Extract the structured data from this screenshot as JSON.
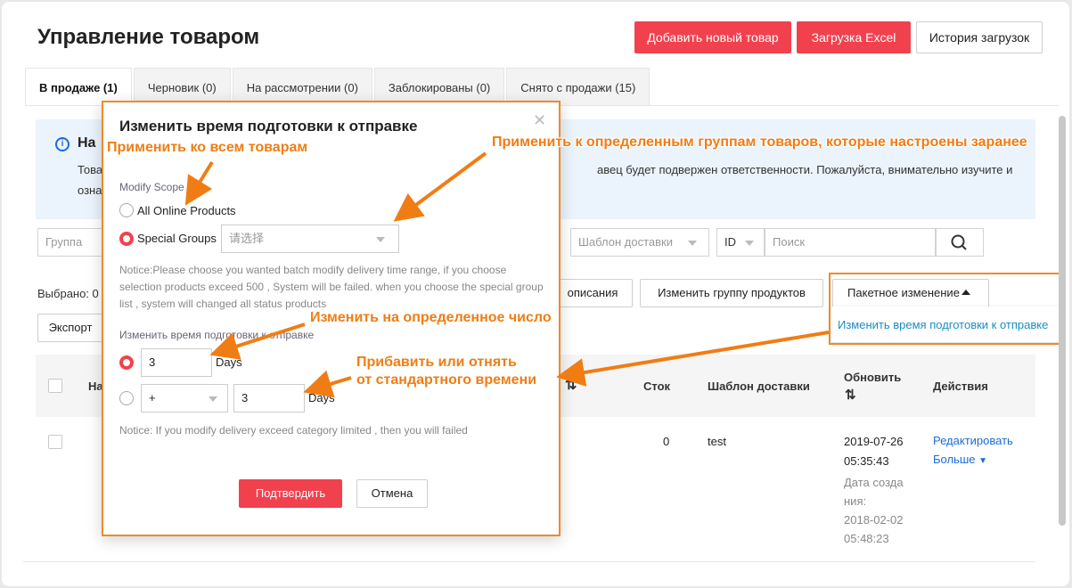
{
  "header": {
    "title": "Управление товаром",
    "add_button": "Добавить новый товар",
    "excel_button": "Загрузка Excel",
    "history_button": "История загрузок"
  },
  "tabs": [
    {
      "label": "В продаже (1)"
    },
    {
      "label": "Черновик (0)"
    },
    {
      "label": "На рассмотрении (0)"
    },
    {
      "label": "Заблокированы (0)"
    },
    {
      "label": "Снято с продажи (15)"
    }
  ],
  "notice": {
    "title_partial": "На",
    "line1_left": "Това",
    "line1_right": "авец будет подвержен ответственности. Пожалуйста, внимательно изучите и",
    "line2_left": "озна"
  },
  "filters": {
    "group_placeholder": "Группа",
    "shipping_template_placeholder": "Шаблон доставки",
    "id_select": "ID",
    "search_placeholder": "Поиск"
  },
  "toolbar": {
    "selected_label": "Выбрано: 0",
    "description_button": "описания",
    "change_group_button": "Изменить группу продуктов",
    "batch_button": "Пакетное изменение",
    "export_button": "Экспорт"
  },
  "dropdown_menu": {
    "item": "Изменить время подготовки к отправке"
  },
  "table": {
    "headers": {
      "name_partial": "На",
      "stock": "Сток",
      "shipping_template": "Шаблон доставки",
      "updated": "Обновить",
      "actions": "Действия"
    },
    "row": {
      "stock": "0",
      "shipping_template": "test",
      "updated_date": "2019-07-26",
      "updated_time": "05:35:43",
      "created_label_1": "Дата созда",
      "created_label_2": "ния:",
      "created_date": "2018-02-02",
      "created_time": "05:48:23",
      "edit_link": "Редактировать",
      "more_link": "Больше"
    }
  },
  "modal": {
    "title": "Изменить время подготовки к отправке",
    "scope_label": "Modify Scope",
    "option_all": "All Online Products",
    "option_groups": "Special Groups",
    "group_select_placeholder": "请选择",
    "notice_lines": [
      "Notice:Please choose you wanted batch modify delivery time range, if you choose",
      "selection products exceed 500 , System will be failed. when you choose the special group",
      "list , system will changed all status products"
    ],
    "time_label": "Изменить время подготовки к отправке",
    "fixed_value": "3",
    "days_label": "Days",
    "operator_value": "+",
    "delta_value": "3",
    "days_label_2": "Days",
    "limit_notice": "Notice: If you modify delivery exceed category limited , then you will failed",
    "confirm_button": "Подтвердить",
    "cancel_button": "Отмена"
  },
  "annotations": {
    "apply_all": "Применить ко всем товарам",
    "apply_groups": "Применить к определенным группам товаров, которые настроены заранее",
    "set_number": "Изменить на определенное число",
    "add_subtract_1": "Прибавить или отнять",
    "add_subtract_2": "от стандартного времени"
  },
  "colors": {
    "brand_red": "#f2414e",
    "annotation_orange": "#ee8a2b",
    "link_blue": "#1a6cd7"
  }
}
